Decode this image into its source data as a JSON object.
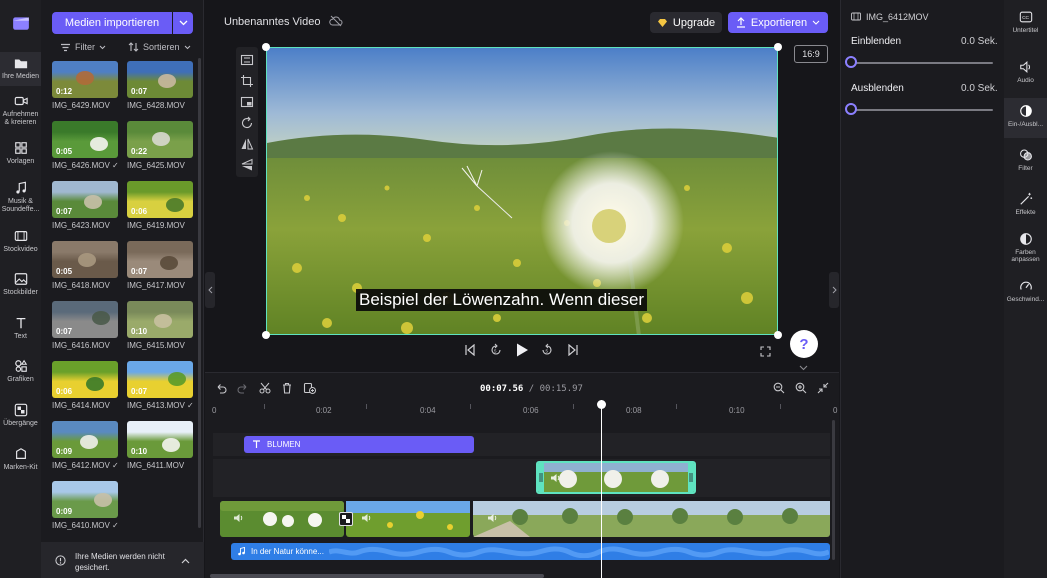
{
  "left_nav": [
    {
      "label": "Ihre Medien",
      "icon": "folder-icon",
      "active": true
    },
    {
      "label": "Aufnehmen & kreieren",
      "icon": "camera-icon"
    },
    {
      "label": "Vorlagen",
      "icon": "template-icon"
    },
    {
      "label": "Musik & Soundeffe...",
      "icon": "music-icon"
    },
    {
      "label": "Stockvideo",
      "icon": "film-icon"
    },
    {
      "label": "Stockbilder",
      "icon": "image-icon"
    },
    {
      "label": "Text",
      "icon": "text-icon"
    },
    {
      "label": "Grafiken",
      "icon": "shapes-icon"
    },
    {
      "label": "Übergänge",
      "icon": "transition-icon"
    },
    {
      "label": "Marken-Kit",
      "icon": "brand-icon"
    }
  ],
  "media": {
    "import_label": "Medien importieren",
    "filter_label": "Filter",
    "sort_label": "Sortieren",
    "items": [
      {
        "name": "IMG_6429.MOV",
        "duration": "0:12",
        "used": false,
        "colors": [
          "#4f7fc4",
          "#7c8a3a",
          "#b06a3a"
        ]
      },
      {
        "name": "IMG_6428.MOV",
        "duration": "0:07",
        "used": false,
        "colors": [
          "#3f6fb8",
          "#6d8a36",
          "#c9b8a0"
        ]
      },
      {
        "name": "IMG_6426.MOV",
        "duration": "0:05",
        "used": true,
        "colors": [
          "#3a7a2a",
          "#5a9a3a",
          "#f4f4f0"
        ]
      },
      {
        "name": "IMG_6425.MOV",
        "duration": "0:22",
        "used": false,
        "colors": [
          "#5a8a3a",
          "#7aa04a",
          "#d8d8d0"
        ]
      },
      {
        "name": "IMG_6423.MOV",
        "duration": "0:07",
        "used": false,
        "colors": [
          "#a0b8d0",
          "#5a8a3a",
          "#c8c0a8"
        ]
      },
      {
        "name": "IMG_6419.MOV",
        "duration": "0:06",
        "used": false,
        "colors": [
          "#6a9a2a",
          "#d8d040",
          "#4a7a2a"
        ]
      },
      {
        "name": "IMG_6418.MOV",
        "duration": "0:05",
        "used": false,
        "colors": [
          "#8a7a6a",
          "#6a5a4a",
          "#a89880"
        ]
      },
      {
        "name": "IMG_6417.MOV",
        "duration": "0:07",
        "used": false,
        "colors": [
          "#7a6a5a",
          "#9a8a7a",
          "#5a4a3a"
        ]
      },
      {
        "name": "IMG_6416.MOV",
        "duration": "0:07",
        "used": false,
        "colors": [
          "#5a6a7a",
          "#8a8a8a",
          "#4a5a4a"
        ]
      },
      {
        "name": "IMG_6415.MOV",
        "duration": "0:10",
        "used": false,
        "colors": [
          "#7a8a5a",
          "#9aaa6a",
          "#c8c0a0"
        ]
      },
      {
        "name": "IMG_6414.MOV",
        "duration": "0:06",
        "used": false,
        "colors": [
          "#6aa02a",
          "#e8d030",
          "#3a7a2a"
        ]
      },
      {
        "name": "IMG_6413.MOV",
        "duration": "0:07",
        "used": true,
        "colors": [
          "#6aa8e8",
          "#e8d030",
          "#5a9a2a"
        ]
      },
      {
        "name": "IMG_6412.MOV",
        "duration": "0:09",
        "used": true,
        "colors": [
          "#5a8ac0",
          "#6a9a3a",
          "#f0f0ea"
        ]
      },
      {
        "name": "IMG_6411.MOV",
        "duration": "0:10",
        "used": false,
        "colors": [
          "#e8f0f8",
          "#6a9a3a",
          "#f4f4f0"
        ]
      },
      {
        "name": "IMG_6410.MOV",
        "duration": "0:09",
        "used": true,
        "colors": [
          "#a8c8e8",
          "#6a9a4a",
          "#c8c0a8"
        ]
      }
    ],
    "notice": "Ihre Medien werden nicht gesichert."
  },
  "topbar": {
    "project_title": "Unbenanntes Video",
    "upgrade_label": "Upgrade",
    "export_label": "Exportieren",
    "aspect_ratio": "16:9"
  },
  "preview": {
    "caption": "Beispiel der Löwenzahn. Wenn dieser",
    "help_label": "?"
  },
  "timeline": {
    "current_time": "00:07.56",
    "total_time": "/ 00:15.97",
    "ticks": [
      "0",
      "0:02",
      "0:04",
      "0:06",
      "0:08",
      "0:10",
      "0"
    ],
    "text_clip_label": "BLUMEN",
    "audio_clip_label": "In der Natur könne..."
  },
  "properties": {
    "clip_name": "IMG_6412MOV",
    "fade_in_label": "Einblenden",
    "fade_in_value": "0.0 Sek.",
    "fade_out_label": "Ausblenden",
    "fade_out_value": "0.0 Sek."
  },
  "right_nav": [
    {
      "label": "Untertitel",
      "icon": "captions-icon"
    },
    {
      "label": "Audio",
      "icon": "speaker-icon"
    },
    {
      "label": "Ein-/Ausbl...",
      "icon": "fade-icon",
      "active": true
    },
    {
      "label": "Filter",
      "icon": "filter-icon"
    },
    {
      "label": "Effekte",
      "icon": "effects-icon"
    },
    {
      "label": "Farben anpassen",
      "icon": "color-icon"
    },
    {
      "label": "Geschwind...",
      "icon": "speed-icon"
    }
  ],
  "colors": {
    "accent": "#6a5cf6",
    "selection": "#5fe3c0",
    "audio": "#2f7ee6"
  }
}
